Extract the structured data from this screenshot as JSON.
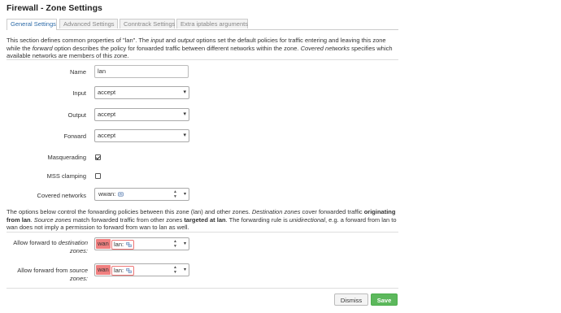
{
  "title": "Firewall - Zone Settings",
  "tabs": [
    "General Settings",
    "Advanced Settings",
    "Conntrack Settings",
    "Extra iptables arguments"
  ],
  "intro": {
    "t1": "This section defines common properties of \"lan\". The ",
    "t2": "input",
    "t3": " and ",
    "t4": "output",
    "t5": " options set the default policies for traffic entering and leaving this zone while the ",
    "t6": "forward",
    "t7": " option describes the policy for forwarded traffic between different networks within the zone. ",
    "t8": "Covered networks",
    "t9": " specifies which available networks are members of this zone."
  },
  "form": {
    "name_label": "Name",
    "name_value": "lan",
    "input_label": "Input",
    "input_value": "accept",
    "output_label": "Output",
    "output_value": "accept",
    "forward_label": "Forward",
    "forward_value": "accept",
    "masq_label": "Masquerading",
    "masq_checked": true,
    "mss_label": "MSS clamping",
    "mss_checked": false,
    "covered_label": "Covered networks",
    "covered_value": "wwan:"
  },
  "forward_desc": {
    "t1": "The options below control the forwarding policies between this zone (lan) and other zones. ",
    "t2": "Destination zones",
    "t3": " cover forwarded traffic ",
    "t4": "originating from lan",
    "t5": ". ",
    "t6": "Source zones",
    "t7": " match forwarded traffic from other zones ",
    "t8": "targeted at lan",
    "t9": ". The forwarding rule is ",
    "t10": "unidirectional",
    "t11": ", e.g. a forward from lan to wan does not imply a permission to forward from wan to lan as well."
  },
  "fwd_dest": {
    "l1": "Allow forward to ",
    "l2": "destination",
    "l3": "zones:",
    "zone1": "wan",
    "zone2": "lan:"
  },
  "fwd_src": {
    "l1": "Allow forward from ",
    "l2": "source",
    "l3": "zones:",
    "zone1": "wan",
    "zone2": "lan:"
  },
  "buttons": {
    "dismiss": "Dismiss",
    "save": "Save"
  },
  "colors": {
    "save": "#5cb85c",
    "zone_red": "#f08080",
    "tab_active": "#2d6ba8"
  }
}
